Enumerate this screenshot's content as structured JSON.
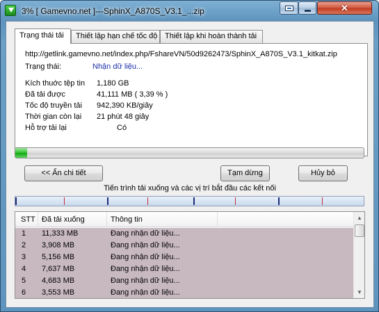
{
  "window": {
    "title": "3% [ Gamevno.net ]---SphinX_A870S_V3.1_...zip",
    "close_glyph": "✕"
  },
  "tabs": [
    {
      "label": "Trạng thái tải",
      "active": true
    },
    {
      "label": "Thiết lập hạn chế tốc độ",
      "active": false
    },
    {
      "label": "Thiết lập khi hoàn thành tải",
      "active": false
    }
  ],
  "download": {
    "url": "http://getlink.gamevno.net/index.php/FshareVN/50d9262473/SphinX_A870S_V3.1_kitkat.zip",
    "status_label": "Trạng thái:",
    "status_value": "Nhận dữ liệu...",
    "stats": [
      {
        "label": "Kích thuớc tệp tin",
        "value": "1,180  GB"
      },
      {
        "label": "Đã tải được",
        "value": "41,111  MB  ( 3,39 % )"
      },
      {
        "label": "Tốc độ truyền tải",
        "value": "942,390  KB/giây"
      },
      {
        "label": "Thời gian còn lại",
        "value": "21 phút 48 giây"
      },
      {
        "label": "Hỗ trợ tải lại",
        "value": "Có"
      }
    ],
    "progress_fraction": 0.0339
  },
  "buttons": {
    "details": "<< Ẩn chi tiết",
    "pause": "Tạm dừng",
    "cancel": "Hủy bỏ"
  },
  "segments_caption": "Tiến trình tải xuống và các vị trí bắt đầu các kết nối",
  "segments": {
    "start_fractions": [
      0.0,
      0.264,
      0.51,
      0.755
    ],
    "line_fractions": [
      0.14,
      0.264,
      0.38,
      0.51,
      0.63,
      0.755,
      0.88
    ]
  },
  "connections": {
    "headers": [
      "STT",
      "Đã tải xuống",
      "Thông tin"
    ],
    "rows": [
      [
        "1",
        "11,333  MB",
        "Đang nhận dữ liệu..."
      ],
      [
        "2",
        "3,908  MB",
        "Đang nhận dữ liệu..."
      ],
      [
        "3",
        "5,156  MB",
        "Đang nhận dữ liệu..."
      ],
      [
        "4",
        "7,637  MB",
        "Đang nhận dữ liệu..."
      ],
      [
        "5",
        "4,683  MB",
        "Đang nhận dữ liệu..."
      ],
      [
        "6",
        "3,553  MB",
        "Đang nhận dữ liệu..."
      ]
    ]
  },
  "colors": {
    "progress": "#2fc22f",
    "row_background": "#c8b9c1",
    "status_value": "#1a2fa8"
  }
}
